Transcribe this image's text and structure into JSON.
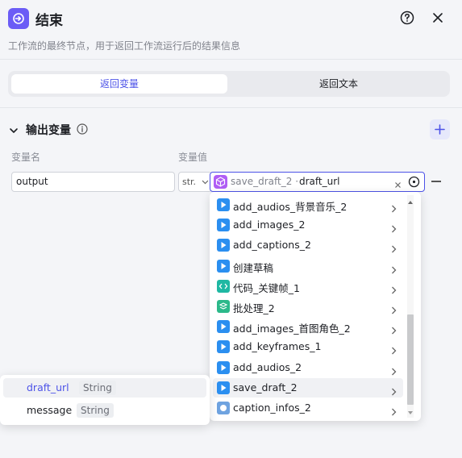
{
  "header": {
    "title": "结束",
    "subtitle": "工作流的最终节点，用于返回工作流运行后的结果信息",
    "accent_color": "#6b5cf6"
  },
  "tabs": [
    {
      "label": "返回变量",
      "active": true
    },
    {
      "label": "返回文本",
      "active": false
    }
  ],
  "section": {
    "title": "输出变量",
    "col_name": "变量名",
    "col_value": "变量值"
  },
  "row": {
    "name_value": "output",
    "type_value": "str.",
    "ref_node": "save_draft_2",
    "ref_separator": "·",
    "ref_var": "draft_url"
  },
  "dropdown": {
    "items": [
      {
        "label": "add_audios_背景音乐_2",
        "icon": "play-node-icon",
        "color": "#2b8ff0"
      },
      {
        "label": "add_images_2",
        "icon": "play-node-icon",
        "color": "#2b8ff0"
      },
      {
        "label": "add_captions_2",
        "icon": "play-node-icon",
        "color": "#2b8ff0"
      },
      {
        "label": "创建草稿",
        "icon": "play-node-icon",
        "color": "#2b8ff0"
      },
      {
        "label": "代码_关键帧_1",
        "icon": "code-node-icon",
        "color": "#1fb8a3"
      },
      {
        "label": "批处理_2",
        "icon": "batch-node-icon",
        "color": "#2cb98a"
      },
      {
        "label": "add_images_首图角色_2",
        "icon": "play-node-icon",
        "color": "#2b8ff0"
      },
      {
        "label": "add_keyframes_1",
        "icon": "play-node-icon",
        "color": "#2b8ff0"
      },
      {
        "label": "add_audios_2",
        "icon": "play-node-icon",
        "color": "#2b8ff0"
      },
      {
        "label": "save_draft_2",
        "icon": "play-node-icon",
        "color": "#2b8ff0",
        "active": true
      },
      {
        "label": "caption_infos_2",
        "icon": "plugin-node-icon",
        "color": "#6fa3e0"
      }
    ]
  },
  "submenu": {
    "items": [
      {
        "name": "draft_url",
        "type": "String",
        "active": true
      },
      {
        "name": "message",
        "type": "String",
        "active": false
      }
    ]
  }
}
